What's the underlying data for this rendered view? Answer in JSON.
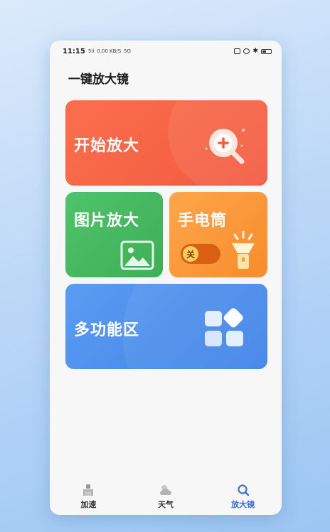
{
  "status_bar": {
    "time": "11:15",
    "signal_text": "5il",
    "speed_text": "0.00 KB/S",
    "hd_text": "5G"
  },
  "app": {
    "title": "一键放大镜"
  },
  "cards": {
    "start": {
      "label": "开始放大",
      "color": "#f4603f"
    },
    "photo": {
      "label": "图片放大",
      "color": "#45b960"
    },
    "torch": {
      "label": "手电筒",
      "toggle_label": "关",
      "color": "#f89636"
    },
    "multi": {
      "label": "多功能区",
      "color": "#4a8cec"
    }
  },
  "tabs": [
    {
      "label": "加速",
      "icon": "broom-icon"
    },
    {
      "label": "天气",
      "icon": "cloud-sun-icon"
    },
    {
      "label": "放大镜",
      "icon": "magnifier-icon",
      "active": true
    }
  ],
  "accent_color": "#3d6fd8"
}
